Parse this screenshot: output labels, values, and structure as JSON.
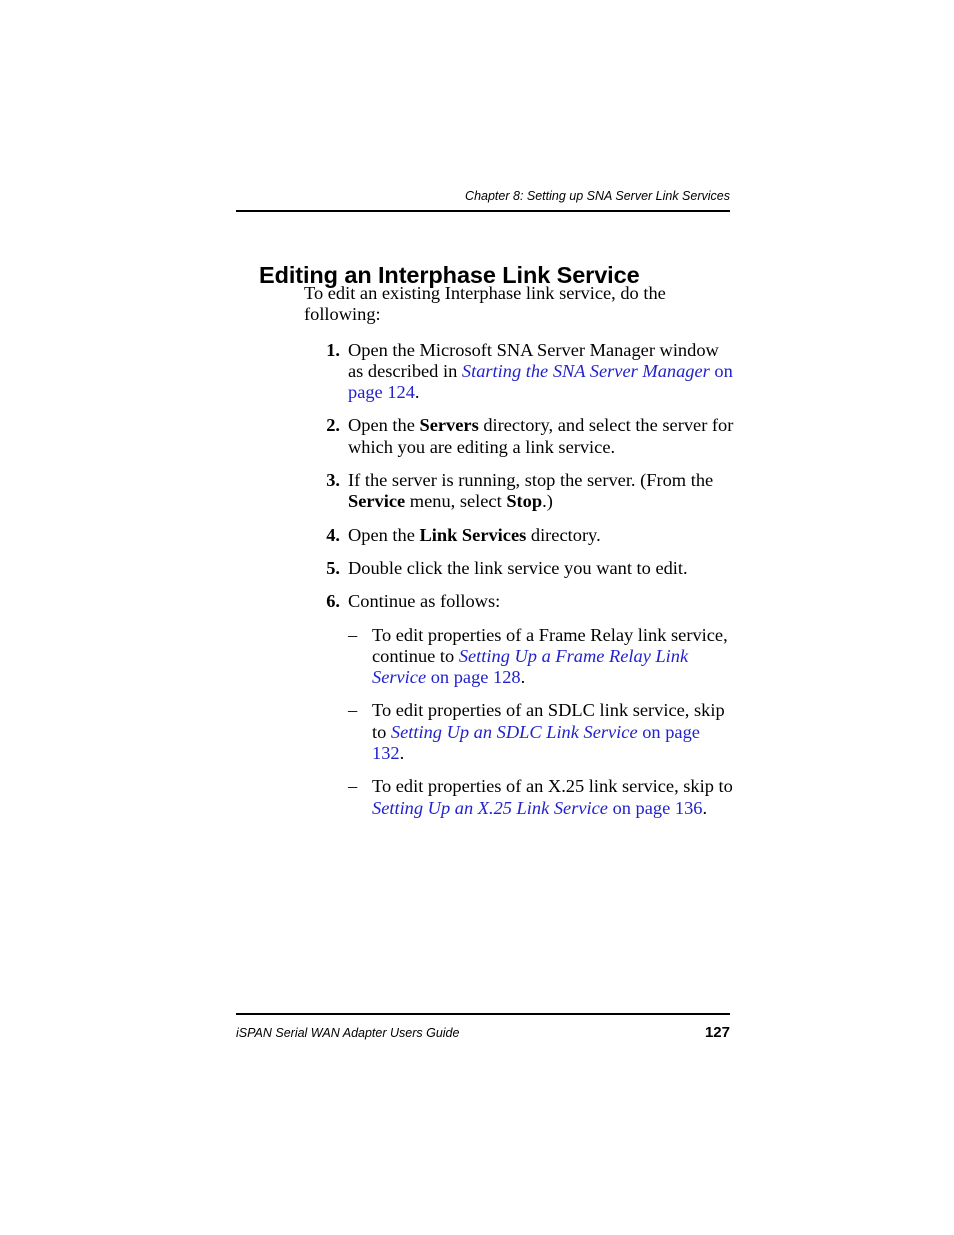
{
  "header": {
    "running_head": "Chapter 8: Setting up SNA Server Link Services"
  },
  "section": {
    "title": "Editing an Interphase Link Service",
    "intro": "To edit an existing Interphase link service, do the following:"
  },
  "steps": [
    {
      "number": "1.",
      "text_before": "Open the Microsoft SNA Server Manager window as described in ",
      "xref_title": "Starting the SNA Server Manager",
      "xref_page": " on page 124",
      "text_after": "."
    },
    {
      "number": "2.",
      "text_before": "Open the ",
      "ui_term": "Servers",
      "text_after": " directory, and select the server for which you are editing a link service."
    },
    {
      "number": "3.",
      "text_before": "If the server is running, stop the server. (From the ",
      "ui_term": "Service",
      "text_mid": " menu, select ",
      "ui_term2": "Stop",
      "text_after": ".)"
    },
    {
      "number": "4.",
      "text_before": "Open the ",
      "ui_term": "Link Services",
      "text_after": " directory."
    },
    {
      "number": "5.",
      "text_before": "Double click the link service you want to edit."
    },
    {
      "number": "6.",
      "text_before": "Continue as follows:"
    }
  ],
  "sub_items": [
    {
      "marker": "–",
      "text_before": "To edit properties of a Frame Relay link service, continue to ",
      "xref_title": "Setting Up a Frame Relay Link Service",
      "xref_page": " on page 128",
      "text_after": "."
    },
    {
      "marker": "–",
      "text_before": "To edit properties of an SDLC link service, skip to ",
      "xref_title": "Setting Up an SDLC Link Service",
      "xref_page": " on page 132",
      "text_after": "."
    },
    {
      "marker": "–",
      "text_before": "To edit properties of an X.25 link service, skip to ",
      "xref_title": "Setting Up an X.25 Link Service",
      "xref_page": " on page 136",
      "text_after": "."
    }
  ],
  "footer": {
    "document_title": "iSPAN Serial WAN Adapter Users Guide",
    "page_number": "127"
  },
  "colors": {
    "link": "#2222CC",
    "text": "#000000",
    "background": "#FFFFFF"
  }
}
